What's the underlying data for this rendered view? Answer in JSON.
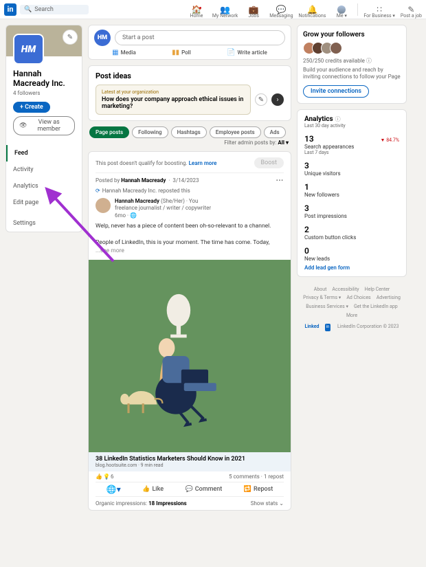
{
  "header": {
    "search_placeholder": "Search",
    "nav": [
      {
        "label": "Home",
        "icon": "🏠"
      },
      {
        "label": "My Network",
        "icon": "👥"
      },
      {
        "label": "Jobs",
        "icon": "💼"
      },
      {
        "label": "Messaging",
        "icon": "💬"
      },
      {
        "label": "Notifications",
        "icon": "🔔"
      },
      {
        "label": "Me ▾",
        "icon": "avatar"
      },
      {
        "label": "For Business ▾",
        "icon": "⋮⋮⋮"
      },
      {
        "label": "Post a job",
        "icon": "✎"
      }
    ]
  },
  "profile": {
    "logo_text": "HM",
    "name": "Hannah Macready Inc.",
    "followers": "4 followers",
    "create_btn": "+ Create",
    "view_as": "View as member",
    "menu": [
      "Feed",
      "Activity",
      "Analytics",
      "Edit page",
      "",
      "Settings"
    ],
    "active_index": 0
  },
  "start_post": {
    "placeholder": "Start a post",
    "media": "Media",
    "poll": "Poll",
    "write": "Write article"
  },
  "ideas": {
    "title": "Post ideas",
    "tag": "Latest at your organization",
    "question": "How does your company approach ethical issues in marketing?"
  },
  "tabs": [
    "Page posts",
    "Following",
    "Hashtags",
    "Employee posts",
    "Ads"
  ],
  "filter": {
    "label": "Filter admin posts by:",
    "value": "All ▾"
  },
  "post": {
    "boost_msg": "This post doesn't qualify for boosting.",
    "learn_more": "Learn more",
    "boost_btn": "Boost",
    "posted_by": "Posted by",
    "author_short": "Hannah Macready",
    "date": "3/14/2023",
    "reposted": "Hannah Macready Inc. reposted this",
    "author": "Hannah Macready",
    "pronouns": "(She/Her)",
    "you": "· You",
    "headline": "freelance journalist / writer / copywriter",
    "time": "6mo · 🌐",
    "text1": "Welp, never has a piece of content been oh-so-relevant to a channel.",
    "text2": "People of LinkedIn, this is your moment. The time has come. Today, ",
    "see_more": "...see more",
    "link_title": "38 LinkedIn Statistics Marketers Should Know in 2021",
    "link_sub": "blog.hootsuite.com · 9 min read",
    "react_count": "6",
    "comments": "5 comments · 1 repost",
    "like": "Like",
    "comment": "Comment",
    "repost": "Repost",
    "impressions_label": "Organic impressions:",
    "impressions": "18 Impressions",
    "show_stats": "Show stats  ⌄"
  },
  "grow": {
    "title": "Grow your followers",
    "credits": "250/250 credits available",
    "text": "Build your audience and reach by inviting connections to follow your Page",
    "btn": "Invite connections"
  },
  "analytics": {
    "title": "Analytics",
    "sub": "Last 30 day activity",
    "stats": [
      {
        "n": "13",
        "label": "Search appearances",
        "sub": "Last 7 days",
        "chg": "▼ 84.7%"
      },
      {
        "n": "3",
        "label": "Unique visitors"
      },
      {
        "n": "1",
        "label": "New followers"
      },
      {
        "n": "3",
        "label": "Post impressions"
      },
      {
        "n": "2",
        "label": "Custom button clicks"
      },
      {
        "n": "0",
        "label": "New leads"
      }
    ],
    "add_lead": "Add lead gen form"
  },
  "footer": {
    "links": [
      "About",
      "Accessibility",
      "Help Center",
      "Privacy & Terms ▾",
      "Ad Choices",
      "Advertising",
      "Business Services ▾",
      "Get the LinkedIn app",
      "More"
    ],
    "corp": "LinkedIn Corporation © 2023"
  }
}
